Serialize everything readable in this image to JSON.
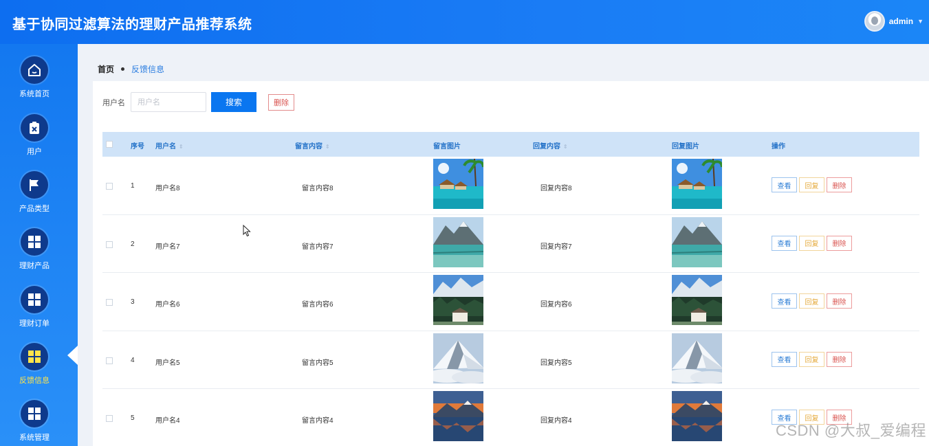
{
  "header": {
    "title": "基于协同过滤算法的理财产品推荐系统",
    "username": "admin"
  },
  "sidebar": {
    "items": [
      {
        "label": "系统首页",
        "icon": "home-icon"
      },
      {
        "label": "用户",
        "icon": "clipboard-x-icon"
      },
      {
        "label": "产品类型",
        "icon": "flag-icon"
      },
      {
        "label": "理财产品",
        "icon": "grid-icon"
      },
      {
        "label": "理财订单",
        "icon": "grid-icon"
      },
      {
        "label": "反馈信息",
        "icon": "grid-icon",
        "active": true
      },
      {
        "label": "系统管理",
        "icon": "grid-icon"
      }
    ],
    "active_color": "#ffe44a"
  },
  "breadcrumb": {
    "home": "首页",
    "current": "反馈信息"
  },
  "search": {
    "label": "用户名",
    "placeholder": "用户名",
    "search_button": "搜索",
    "delete_button": "删除"
  },
  "table": {
    "columns": [
      "序号",
      "用户名",
      "留言内容",
      "留言图片",
      "回复内容",
      "回复图片",
      "操作"
    ],
    "rows": [
      {
        "index": "1",
        "username": "用户名8",
        "message": "留言内容8",
        "reply": "回复内容8",
        "image": "tropical-bungalow-image"
      },
      {
        "index": "2",
        "username": "用户名7",
        "message": "留言内容7",
        "reply": "回复内容7",
        "image": "mountain-lake-image"
      },
      {
        "index": "3",
        "username": "用户名6",
        "message": "留言内容6",
        "reply": "回复内容6",
        "image": "mountain-village-image"
      },
      {
        "index": "4",
        "username": "用户名5",
        "message": "留言内容5",
        "reply": "回复内容5",
        "image": "snow-peak-image"
      },
      {
        "index": "5",
        "username": "用户名4",
        "message": "留言内容4",
        "reply": "回复内容4",
        "image": "sunset-mountain-image"
      }
    ],
    "actions": {
      "view": "查看",
      "reply": "回复",
      "delete": "删除"
    }
  },
  "watermark": "CSDN @大叔_爱编程",
  "colors": {
    "header": "#0d6ef0",
    "primary_button": "#0a76f0",
    "table_header": "#cfe3f8"
  }
}
